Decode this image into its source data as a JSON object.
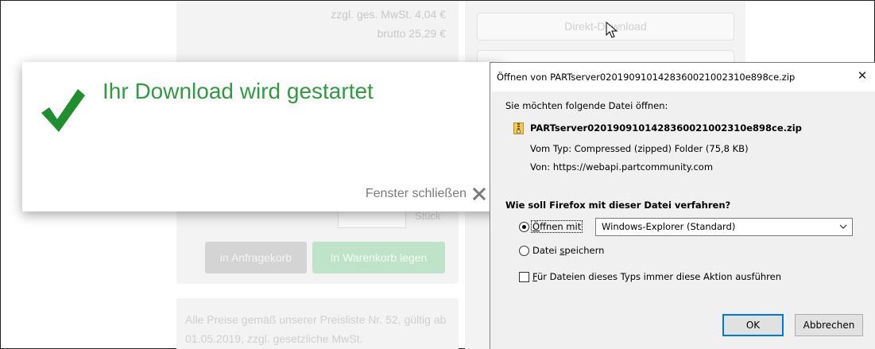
{
  "background_page": {
    "price_vat": "zzgl. ges. MwSt. 4,04 €",
    "price_gross": "brutto 25,29 €",
    "direct_download_label": "Direkt-Download",
    "quantity_unit": "Stück",
    "inquiry_button_label": "in Anfragekorb",
    "cart_button_label": "In Warenkorb legen",
    "price_note": "Alle Preise gemäß unserer Preisliste Nr. 52, gültig ab 01.05.2019, zzgl. gesetzliche MwSt."
  },
  "download_modal": {
    "title": "Ihr Download wird gestartet",
    "close_label": "Fenster schließen",
    "check_color": "#1e8e2e",
    "title_color": "#2f9a3f"
  },
  "firefox_dialog": {
    "title": "Öffnen von PARTserver020190910142836002100231​0e898ce.zip",
    "close_glyph": "✕",
    "prompt": "Sie möchten folgende Datei öffnen:",
    "file_name": "PARTserver020190910142836002100231​0e898ce.zip",
    "file_type": "Vom Typ:  Compressed (zipped) Folder (75,8 KB)",
    "file_source": "Von:  https://webapi.partcommunity.com",
    "question": "Wie soll Firefox mit dieser Datei verfahren?",
    "open_with_label_prefix": "",
    "open_with_accel": "Ö",
    "open_with_rest": "ffnen mit",
    "open_with_selected": true,
    "application_value": "Windows-Explorer (Standard)",
    "save_label_prefix": "Datei ",
    "save_accel": "s",
    "save_rest": "peichern",
    "always_accel": "F",
    "always_rest": "ür Dateien dieses Typs immer diese Aktion ausführen",
    "always_checked": false,
    "ok_label": "OK",
    "cancel_label": "Abbrechen",
    "focus_color": "#0078d7"
  }
}
